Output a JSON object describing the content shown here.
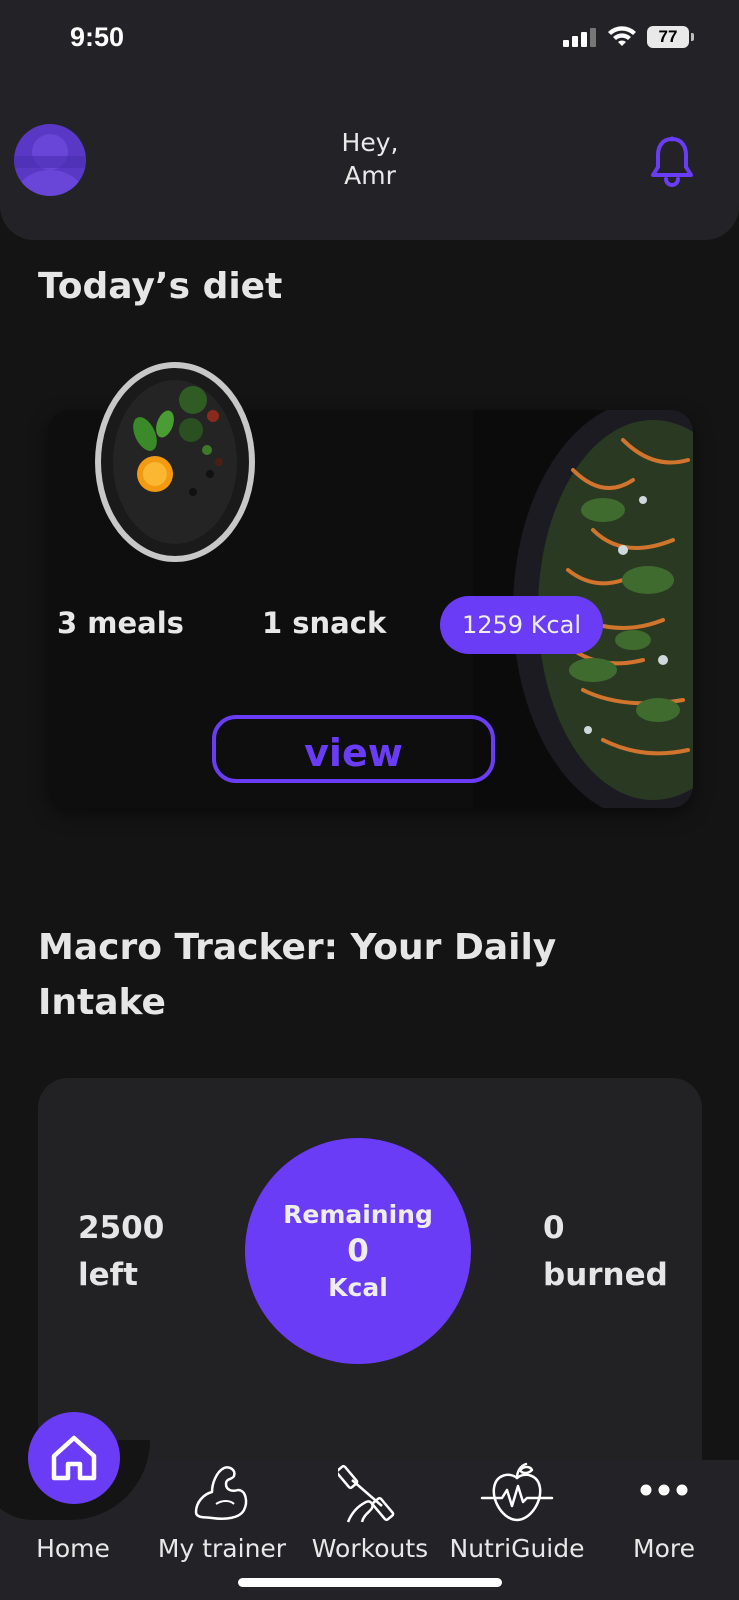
{
  "status_bar": {
    "time": "9:50",
    "battery": "77"
  },
  "header": {
    "greeting_line1": "Hey,",
    "greeting_line2": "Amr"
  },
  "diet": {
    "title": "Today’s diet",
    "meals": "3 meals",
    "snacks": "1 snack",
    "kcal": "1259 Kcal",
    "view_label": "view"
  },
  "macro": {
    "title_line1": "Macro Tracker: Your Daily",
    "title_line2": "Intake",
    "left_value": "2500",
    "left_label": "left",
    "remaining_label": "Remaining",
    "remaining_value": "0",
    "remaining_unit": "Kcal",
    "burned_value": "0",
    "burned_label": "burned"
  },
  "nav": {
    "items": [
      {
        "label": "Home",
        "icon": "home-icon"
      },
      {
        "label": "My trainer",
        "icon": "flexed-arm-icon"
      },
      {
        "label": "Workouts",
        "icon": "dumbbell-icon"
      },
      {
        "label": "NutriGuide",
        "icon": "apple-heartbeat-icon"
      },
      {
        "label": "More",
        "icon": "more-icon"
      }
    ]
  },
  "colors": {
    "accent": "#6b3cf5",
    "background": "#141414",
    "card": "#222124"
  }
}
